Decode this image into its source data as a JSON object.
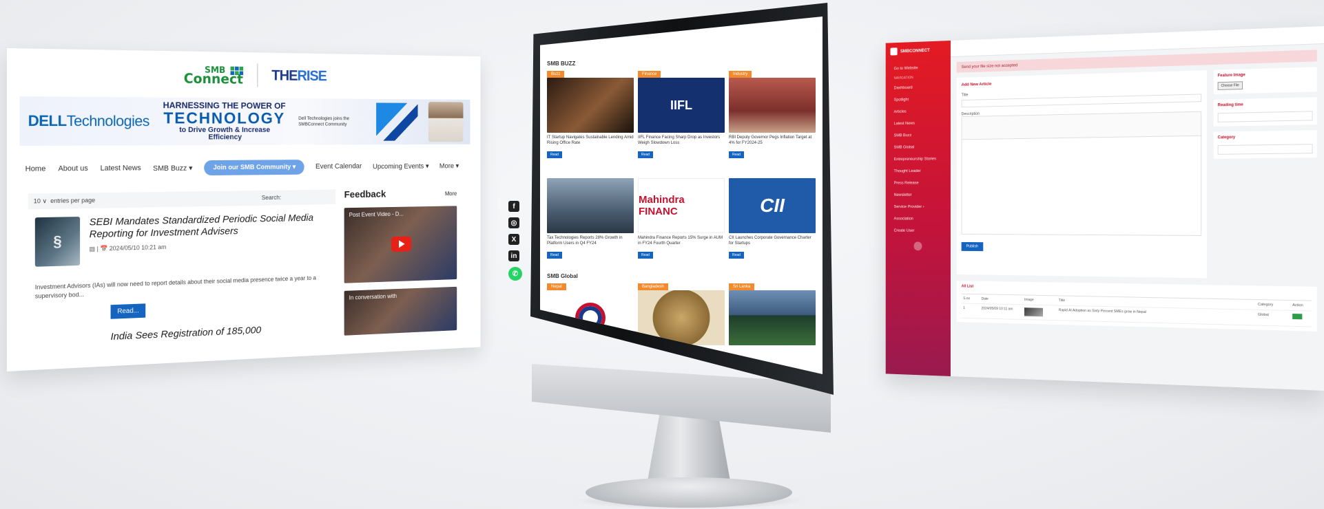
{
  "left_site": {
    "logo_smb_line1": "SMB",
    "logo_smb_line2": "Connect",
    "logo_therise": "THE",
    "logo_therise_accent": "RISE",
    "banner": {
      "dell_bold": "DELL",
      "dell_rest": "Technologies",
      "line1": "HARNESSING THE POWER OF",
      "line2": "TECHNOLOGY",
      "line3": "to Drive Growth & Increase Efficiency",
      "small": "Dell Technologies joins the SMBConnect Community"
    },
    "nav": [
      "Home",
      "About us",
      "Latest News",
      "SMB Buzz ▾",
      "Event Calendar",
      "Upcoming Events ▾",
      "More ▾"
    ],
    "join_button": "Join our SMB Community ▾",
    "entries_select": "10 ∨",
    "entries_label": "entries per page",
    "search_label": "Search:",
    "article": {
      "title": "SEBI Mandates Standardized Periodic Social Media Reporting for Investment Advisers",
      "meta": "▤  |  📅  2024/05/10 10:21 am",
      "desc": "Investment Advisors (IAs) will now need to report details about their social media presence twice a year to a supervisory bod...",
      "read_more": "Read..."
    },
    "article2_title": "India Sees Registration of 185,000",
    "feedback_title": "Feedback",
    "feedback_more": "More",
    "video1_caption": "Post Event Video - D...",
    "video2_caption": "In conversation with"
  },
  "monitor_site": {
    "section1": "SMB BUZZ",
    "section2": "SMB Global",
    "cards": [
      {
        "tag": "Buzz",
        "pic": "",
        "title": "IT Startup Navigates Sustainable Lending Amid Rising Office Rate",
        "btn": "Read"
      },
      {
        "tag": "Finance",
        "pic": "IIFL",
        "title": "IIFL Finance Facing Sharp Drop as Investors Weigh Slowdown Loss",
        "btn": "Read"
      },
      {
        "tag": "Industry",
        "pic": "",
        "title": "RBI Deputy Governor Pegs Inflation Target at 4% for FY2024-25",
        "btn": "Read"
      },
      {
        "tag": "",
        "pic": "",
        "title": "Tax Technologies Reports 28% Growth in Platform Users in Q4 FY24",
        "btn": "Read"
      },
      {
        "tag": "",
        "pic": "Mahindra FINANC",
        "title": "Mahindra Finance Reports 15% Surge in AUM in FY24 Fourth Quarter",
        "btn": "Read"
      },
      {
        "tag": "",
        "pic": "CII",
        "title": "CII Launches Corporate Governance Charter for Startups",
        "btn": "Read"
      }
    ],
    "global_tags": [
      "Nepal",
      "Bangladesh",
      "Sri Lanka"
    ]
  },
  "right_app": {
    "brand": "SMBCONNECT",
    "nav": [
      "Go to Website",
      "Dashboard",
      "Spotlight",
      "Articles",
      "Latest News",
      "SMB Buzz",
      "SMB Global",
      "Entrepreneurship Stories",
      "Thought Leader",
      "Press Release",
      "Newsletter",
      "Service Provider ›",
      "Association",
      "Create User"
    ],
    "nav_small": "NAVIGATION",
    "alert": "Send your file size not accepted",
    "form_title": "Add New Article",
    "field_title": "Title",
    "field_desc": "Description",
    "publish": "Publish",
    "feature_image": "Feature Image",
    "choose_file": "Choose File",
    "reading_time": "Reading time",
    "category": "Category",
    "list_title": "All List",
    "table_headers": [
      "S.no",
      "Date",
      "Image",
      "Title",
      "Category",
      "Action"
    ],
    "table_row": [
      "1",
      "2024/05/09 10:11 am",
      "",
      "Rapid AI Adoption as Sixty Percent SMEs grow in Nepal",
      "Global",
      ""
    ]
  },
  "colors": {
    "brand_red": "#e31b23",
    "brand_blue": "#1565c0",
    "tag_orange": "#f28b2e"
  }
}
